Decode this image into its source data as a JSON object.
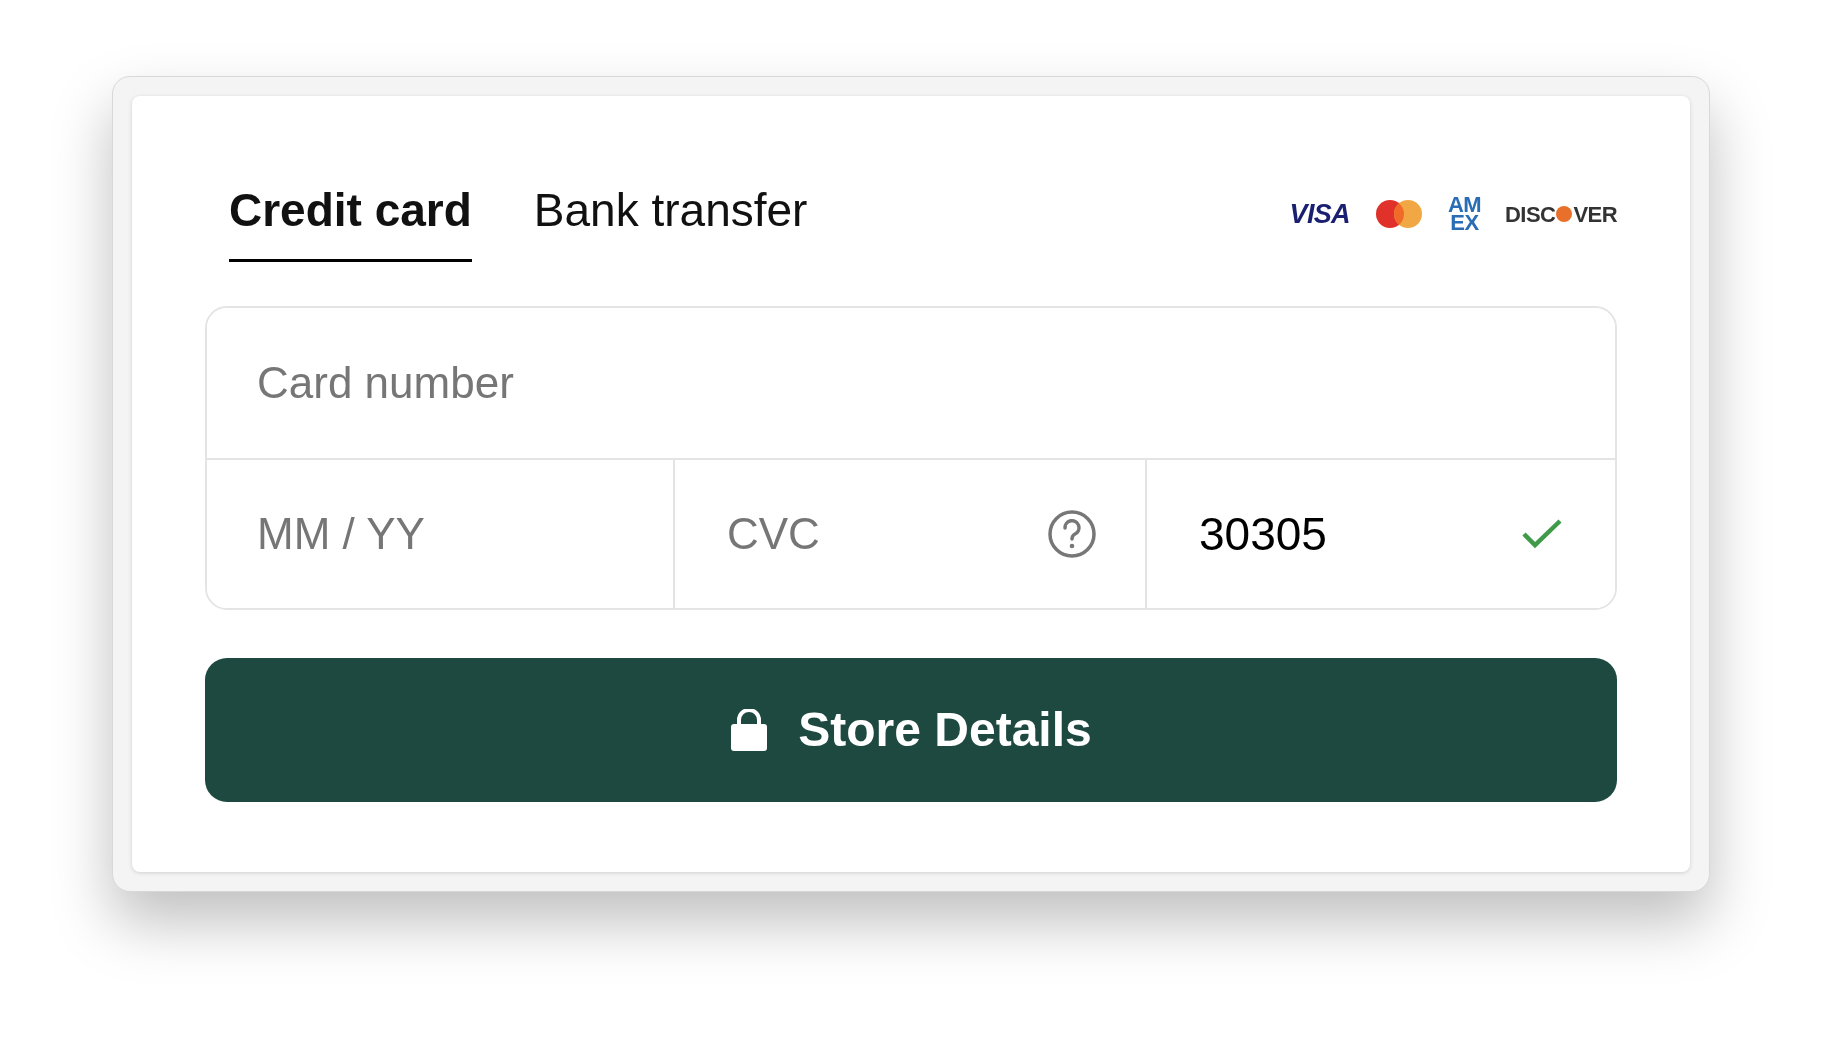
{
  "tabs": [
    {
      "label": "Credit card",
      "selected": true
    },
    {
      "label": "Bank transfer",
      "selected": false
    }
  ],
  "brands": [
    {
      "kind": "visa",
      "parts": [
        "VISA"
      ]
    },
    {
      "kind": "mastercard"
    },
    {
      "kind": "amex",
      "parts": [
        "AM",
        "EX"
      ]
    },
    {
      "kind": "discover",
      "parts": [
        "DISC",
        "VER"
      ]
    }
  ],
  "card_number": {
    "placeholder": "Card number"
  },
  "expiry": {
    "placeholder": "MM / YY"
  },
  "cvc": {
    "placeholder": "CVC"
  },
  "postal": {
    "value": "30305",
    "valid": true
  },
  "button": {
    "label": "Store Details"
  }
}
